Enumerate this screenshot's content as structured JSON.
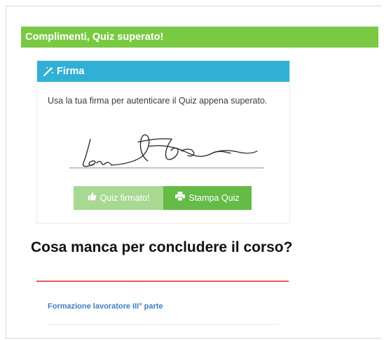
{
  "success_banner": "Complimenti, Quiz superato!",
  "signature_card": {
    "header": "Firma",
    "header_icon": "magic-wand-icon",
    "instructions": "Usa la tua firma per autenticare il Quiz appena superato.",
    "signed_button": {
      "label": "Quiz firmato!",
      "icon": "thumbs-up-icon"
    },
    "print_button": {
      "label": "Stampa Quiz",
      "icon": "print-icon"
    }
  },
  "section_title": "Cosa manca per concludere il corso?",
  "course_item": "Formazione lavoratore III° parte",
  "colors": {
    "success": "#7ac943",
    "info": "#31b0d5",
    "signed_button": "#a8d992",
    "print_button": "#64bb47",
    "divider": "#e35d50",
    "link": "#3d7fc2"
  }
}
